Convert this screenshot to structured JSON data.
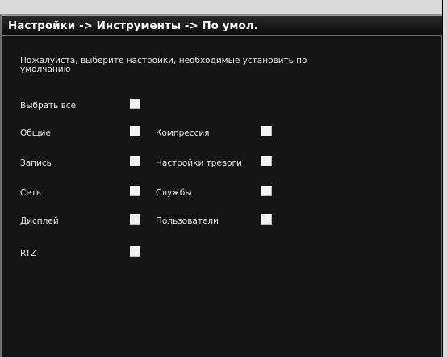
{
  "window": {
    "title": "Настройки -> Инструменты -> По умол."
  },
  "instruction": "Пожалуйста, выберите настройки, необходимые установить по умолчанию",
  "options": {
    "select_all": {
      "label": "Выбрать все",
      "checked": false
    },
    "general": {
      "label": "Общие",
      "checked": false
    },
    "compression": {
      "label": "Компрессия",
      "checked": false
    },
    "record": {
      "label": "Запись",
      "checked": false
    },
    "alarm_settings": {
      "label": "Настройки тревоги",
      "checked": false
    },
    "network": {
      "label": "Сеть",
      "checked": false
    },
    "services": {
      "label": "Службы",
      "checked": false
    },
    "display": {
      "label": "Дисплей",
      "checked": false
    },
    "users": {
      "label": "Пользователи",
      "checked": false
    },
    "rtz": {
      "label": "RTZ",
      "checked": false
    }
  },
  "colors": {
    "background": "#141414",
    "text": "#e8e8e8",
    "checkbox": "#f2f2f2"
  }
}
